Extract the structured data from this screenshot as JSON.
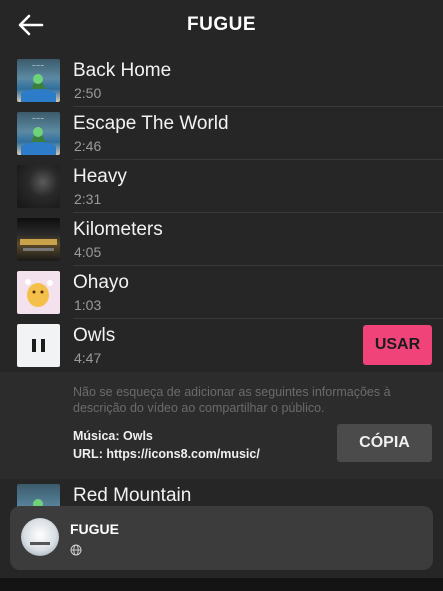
{
  "header": {
    "title": "FUGUE"
  },
  "tracks": [
    {
      "name": "Back Home",
      "duration": "2:50"
    },
    {
      "name": "Escape The World",
      "duration": "2:46"
    },
    {
      "name": "Heavy",
      "duration": "2:31"
    },
    {
      "name": "Kilometers",
      "duration": "4:05"
    },
    {
      "name": "Ohayo",
      "duration": "1:03"
    },
    {
      "name": "Owls",
      "duration": "4:47"
    },
    {
      "name": "Red Mountain",
      "duration": ""
    }
  ],
  "use_button": "USAR",
  "info": {
    "notice": "Não se esqueça de adicionar as seguintes informações à descrição do vídeo ao compartilhar o público.",
    "music_line": "Música: Owls",
    "url_line": "URL: https://icons8.com/music/",
    "copy_button": "CÓPIA"
  },
  "player": {
    "title": "FUGUE"
  },
  "colors": {
    "accent": "#f0437a",
    "background": "#262626"
  }
}
